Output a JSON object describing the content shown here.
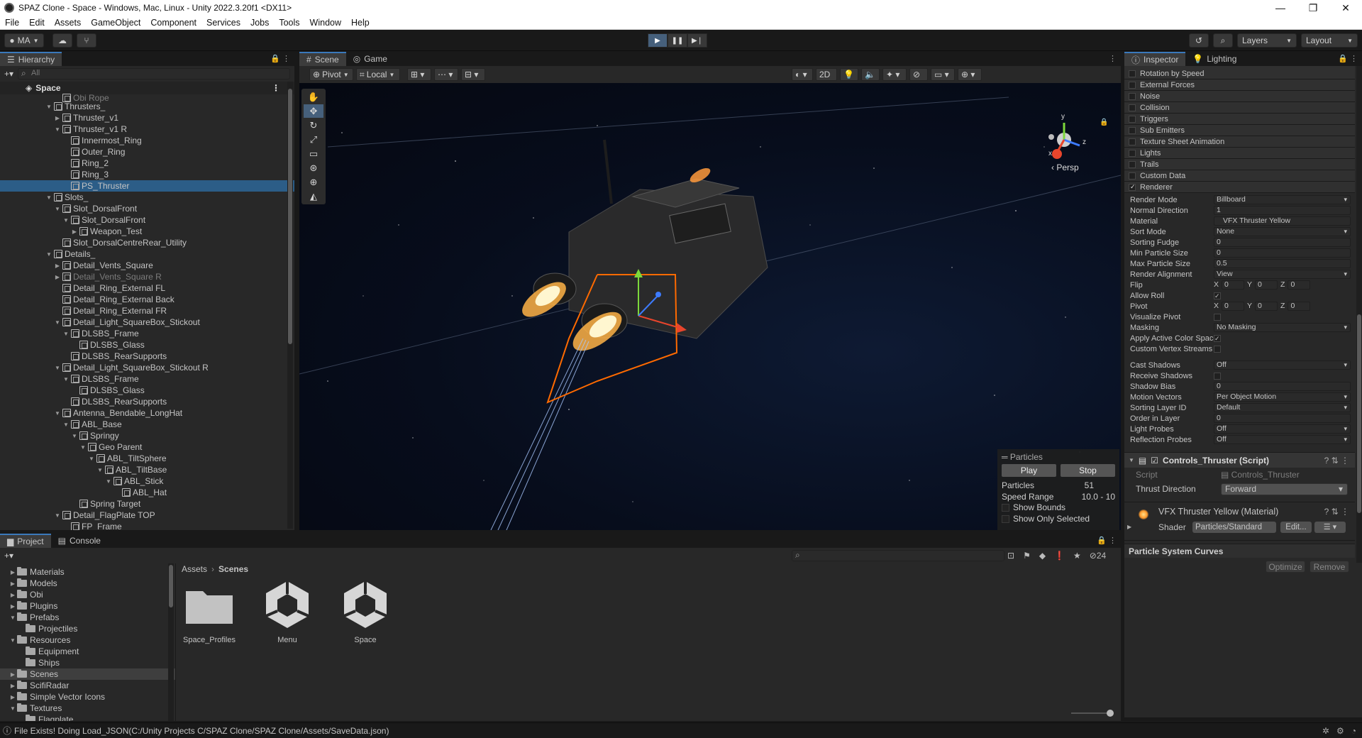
{
  "window": {
    "title": "SPAZ Clone - Space - Windows, Mac, Linux - Unity 2022.3.20f1 <DX11>",
    "controls": [
      "—",
      "❐",
      "✕"
    ]
  },
  "menu": [
    "File",
    "Edit",
    "Assets",
    "GameObject",
    "Component",
    "Services",
    "Jobs",
    "Tools",
    "Window",
    "Help"
  ],
  "toolbar": {
    "account": "MA",
    "layers": "Layers",
    "layout": "Layout"
  },
  "hierarchy": {
    "tab": "Hierarchy",
    "search_placeholder": "All",
    "scene_name": "Space",
    "rows": [
      {
        "label": "Obi Rope",
        "depth": 4,
        "arrow": "",
        "cls": "dim"
      },
      {
        "label": "Thrusters_",
        "depth": 3,
        "arrow": "▼",
        "cls": ""
      },
      {
        "label": "Thruster_v1",
        "depth": 4,
        "arrow": "▶",
        "cls": ""
      },
      {
        "label": "Thruster_v1 R",
        "depth": 4,
        "arrow": "▼",
        "cls": ""
      },
      {
        "label": "Innermost_Ring",
        "depth": 5,
        "arrow": "",
        "cls": ""
      },
      {
        "label": "Outer_Ring",
        "depth": 5,
        "arrow": "",
        "cls": ""
      },
      {
        "label": "Ring_2",
        "depth": 5,
        "arrow": "",
        "cls": ""
      },
      {
        "label": "Ring_3",
        "depth": 5,
        "arrow": "",
        "cls": ""
      },
      {
        "label": "PS_Thruster",
        "depth": 5,
        "arrow": "",
        "cls": "selected"
      },
      {
        "label": "Slots_",
        "depth": 3,
        "arrow": "▼",
        "cls": ""
      },
      {
        "label": "Slot_DorsalFront",
        "depth": 4,
        "arrow": "▼",
        "cls": ""
      },
      {
        "label": "Slot_DorsalFront",
        "depth": 5,
        "arrow": "▼",
        "cls": ""
      },
      {
        "label": "Weapon_Test",
        "depth": 6,
        "arrow": "▶",
        "cls": ""
      },
      {
        "label": "Slot_DorsalCentreRear_Utility",
        "depth": 4,
        "arrow": "",
        "cls": ""
      },
      {
        "label": "Details_",
        "depth": 3,
        "arrow": "▼",
        "cls": ""
      },
      {
        "label": "Detail_Vents_Square",
        "depth": 4,
        "arrow": "▶",
        "cls": ""
      },
      {
        "label": "Detail_Vents_Square R",
        "depth": 4,
        "arrow": "▶",
        "cls": "dim"
      },
      {
        "label": "Detail_Ring_External FL",
        "depth": 4,
        "arrow": "",
        "cls": ""
      },
      {
        "label": "Detail_Ring_External Back",
        "depth": 4,
        "arrow": "",
        "cls": ""
      },
      {
        "label": "Detail_Ring_External FR",
        "depth": 4,
        "arrow": "",
        "cls": ""
      },
      {
        "label": "Detail_Light_SquareBox_Stickout",
        "depth": 4,
        "arrow": "▼",
        "cls": ""
      },
      {
        "label": "DLSBS_Frame",
        "depth": 5,
        "arrow": "▼",
        "cls": ""
      },
      {
        "label": "DLSBS_Glass",
        "depth": 6,
        "arrow": "",
        "cls": ""
      },
      {
        "label": "DLSBS_RearSupports",
        "depth": 5,
        "arrow": "",
        "cls": ""
      },
      {
        "label": "Detail_Light_SquareBox_Stickout R",
        "depth": 4,
        "arrow": "▼",
        "cls": ""
      },
      {
        "label": "DLSBS_Frame",
        "depth": 5,
        "arrow": "▼",
        "cls": ""
      },
      {
        "label": "DLSBS_Glass",
        "depth": 6,
        "arrow": "",
        "cls": ""
      },
      {
        "label": "DLSBS_RearSupports",
        "depth": 5,
        "arrow": "",
        "cls": ""
      },
      {
        "label": "Antenna_Bendable_LongHat",
        "depth": 4,
        "arrow": "▼",
        "cls": ""
      },
      {
        "label": "ABL_Base",
        "depth": 5,
        "arrow": "▼",
        "cls": ""
      },
      {
        "label": "Springy",
        "depth": 6,
        "arrow": "▼",
        "cls": ""
      },
      {
        "label": "Geo Parent",
        "depth": 7,
        "arrow": "▼",
        "cls": ""
      },
      {
        "label": "ABL_TiltSphere",
        "depth": 8,
        "arrow": "▼",
        "cls": ""
      },
      {
        "label": "ABL_TiltBase",
        "depth": 9,
        "arrow": "▼",
        "cls": ""
      },
      {
        "label": "ABL_Stick",
        "depth": 10,
        "arrow": "▼",
        "cls": ""
      },
      {
        "label": "ABL_Hat",
        "depth": 11,
        "arrow": "",
        "cls": ""
      },
      {
        "label": "Spring Target",
        "depth": 6,
        "arrow": "",
        "cls": ""
      },
      {
        "label": "Detail_FlagPlate TOP",
        "depth": 4,
        "arrow": "▼",
        "cls": ""
      },
      {
        "label": "FP_Frame",
        "depth": 5,
        "arrow": "",
        "cls": ""
      }
    ]
  },
  "scene": {
    "tabs": [
      "Scene",
      "Game"
    ],
    "pivot": "Pivot",
    "space": "Local",
    "mode_2d": "2D",
    "persp": "Persp",
    "axis_x": "x",
    "axis_y": "y",
    "axis_z": "z",
    "particles": {
      "header": "Particles",
      "play": "Play",
      "stop": "Stop",
      "particles_label": "Particles",
      "particles_value": "51",
      "speed_label": "Speed Range",
      "speed_value": "10.0 - 10",
      "show_bounds": "Show Bounds",
      "show_only_selected": "Show Only Selected"
    }
  },
  "inspector": {
    "tabs": [
      "Inspector",
      "Lighting"
    ],
    "modules": [
      {
        "label": "Rotation by Speed",
        "on": false
      },
      {
        "label": "External Forces",
        "on": false
      },
      {
        "label": "Noise",
        "on": false
      },
      {
        "label": "Collision",
        "on": false
      },
      {
        "label": "Triggers",
        "on": false
      },
      {
        "label": "Sub Emitters",
        "on": false
      },
      {
        "label": "Texture Sheet Animation",
        "on": false
      },
      {
        "label": "Lights",
        "on": false
      },
      {
        "label": "Trails",
        "on": false
      },
      {
        "label": "Custom Data",
        "on": false
      },
      {
        "label": "Renderer",
        "on": true
      }
    ],
    "renderer_props": [
      {
        "label": "Render Mode",
        "value": "Billboard",
        "type": "dd"
      },
      {
        "label": "Normal Direction",
        "value": "1",
        "type": "field"
      },
      {
        "label": "Material",
        "value": "VFX Thruster Yellow",
        "type": "obj"
      },
      {
        "label": "Sort Mode",
        "value": "None",
        "type": "dd"
      },
      {
        "label": "Sorting Fudge",
        "value": "0",
        "type": "field"
      },
      {
        "label": "Min Particle Size",
        "value": "0",
        "type": "field"
      },
      {
        "label": "Max Particle Size",
        "value": "0.5",
        "type": "field"
      },
      {
        "label": "Render Alignment",
        "value": "View",
        "type": "dd"
      },
      {
        "label": "Flip",
        "value": "",
        "type": "xyz",
        "x": "0",
        "y": "0",
        "z": "0"
      },
      {
        "label": "Allow Roll",
        "value": "",
        "type": "check",
        "on": true
      },
      {
        "label": "Pivot",
        "value": "",
        "type": "xyz",
        "x": "0",
        "y": "0",
        "z": "0"
      },
      {
        "label": "Visualize Pivot",
        "value": "",
        "type": "check",
        "on": false
      },
      {
        "label": "Masking",
        "value": "No Masking",
        "type": "dd"
      },
      {
        "label": "Apply Active Color Space",
        "value": "",
        "type": "check",
        "on": true
      },
      {
        "label": "Custom Vertex Streams",
        "value": "",
        "type": "check",
        "on": false
      },
      {
        "label": "",
        "value": "",
        "type": "gap"
      },
      {
        "label": "Cast Shadows",
        "value": "Off",
        "type": "dd"
      },
      {
        "label": "Receive Shadows",
        "value": "",
        "type": "check",
        "on": false
      },
      {
        "label": "Shadow Bias",
        "value": "0",
        "type": "field"
      },
      {
        "label": "Motion Vectors",
        "value": "Per Object Motion",
        "type": "dd"
      },
      {
        "label": "Sorting Layer ID",
        "value": "Default",
        "type": "dd"
      },
      {
        "label": "Order in Layer",
        "value": "0",
        "type": "field"
      },
      {
        "label": "Light Probes",
        "value": "Off",
        "type": "dd"
      },
      {
        "label": "Reflection Probes",
        "value": "Off",
        "type": "dd"
      }
    ],
    "script_component": {
      "title": "Controls_Thruster (Script)",
      "script_label": "Script",
      "script_value": "Controls_Thruster",
      "thrust_label": "Thrust Direction",
      "thrust_value": "Forward"
    },
    "material": {
      "title": "VFX Thruster Yellow (Material)",
      "shader_label": "Shader",
      "shader_value": "Particles/Standard",
      "edit": "Edit..."
    },
    "curves": {
      "title": "Particle System Curves",
      "optimize": "Optimize",
      "remove": "Remove"
    }
  },
  "project": {
    "tabs": [
      "Project",
      "Console"
    ],
    "hidden_count": "24",
    "tree": [
      {
        "label": "Materials",
        "depth": 1,
        "arrow": "▶",
        "sel": false
      },
      {
        "label": "Models",
        "depth": 1,
        "arrow": "▶",
        "sel": false
      },
      {
        "label": "Obi",
        "depth": 1,
        "arrow": "▶",
        "sel": false
      },
      {
        "label": "Plugins",
        "depth": 1,
        "arrow": "▶",
        "sel": false
      },
      {
        "label": "Prefabs",
        "depth": 1,
        "arrow": "▼",
        "sel": false
      },
      {
        "label": "Projectiles",
        "depth": 2,
        "arrow": "",
        "sel": false
      },
      {
        "label": "Resources",
        "depth": 1,
        "arrow": "▼",
        "sel": false
      },
      {
        "label": "Equipment",
        "depth": 2,
        "arrow": "",
        "sel": false
      },
      {
        "label": "Ships",
        "depth": 2,
        "arrow": "",
        "sel": false
      },
      {
        "label": "Scenes",
        "depth": 1,
        "arrow": "▶",
        "sel": true
      },
      {
        "label": "ScifiRadar",
        "depth": 1,
        "arrow": "▶",
        "sel": false
      },
      {
        "label": "Simple Vector Icons",
        "depth": 1,
        "arrow": "▶",
        "sel": false
      },
      {
        "label": "Textures",
        "depth": 1,
        "arrow": "▼",
        "sel": false
      },
      {
        "label": "Flagplate",
        "depth": 2,
        "arrow": "",
        "sel": false
      }
    ],
    "breadcrumb": [
      "Assets",
      "Scenes"
    ],
    "assets": [
      {
        "label": "Space_Profiles",
        "kind": "folder"
      },
      {
        "label": "Menu",
        "kind": "unity"
      },
      {
        "label": "Space",
        "kind": "unity"
      }
    ]
  },
  "status": {
    "message": "File Exists! Doing Load_JSON(C:/Unity Projects C/SPAZ Clone/SPAZ Clone/Assets/SaveData.json)"
  }
}
